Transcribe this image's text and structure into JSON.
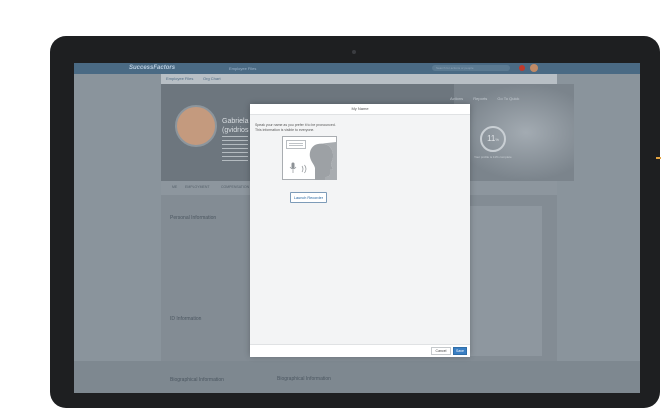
{
  "app": {
    "logo": "SuccessFactors",
    "module": "Employee Files",
    "search_placeholder": "Search for actions or people",
    "colors": {
      "brand": "#4a6a84",
      "accent": "#3a7fc4"
    }
  },
  "subnav": {
    "items": [
      "Employee Files",
      "Org Chart"
    ]
  },
  "profile": {
    "name_line1": "Gabriela",
    "name_line2": "(gvidrios",
    "completion": "11",
    "completion_unit": "%",
    "completion_caption": "Your profile is 11% complete",
    "actions": [
      "Actions",
      "Reports",
      "Go To Quick"
    ]
  },
  "tabs": [
    "ME",
    "EMPLOYMENT",
    "COMPENSATION"
  ],
  "sections": {
    "personal": "Personal Information",
    "id": "ID Information",
    "biographical": "Biographical Information",
    "biographical_card": "Biographical Information"
  },
  "modal": {
    "title": "My Name",
    "instruction_line1": "Speak your name as you prefer it to be pronounced.",
    "instruction_line2": "This information is visible to everyone.",
    "launch_label": "Launch Recorder",
    "cancel_label": "Cancel",
    "save_label": "Save"
  }
}
